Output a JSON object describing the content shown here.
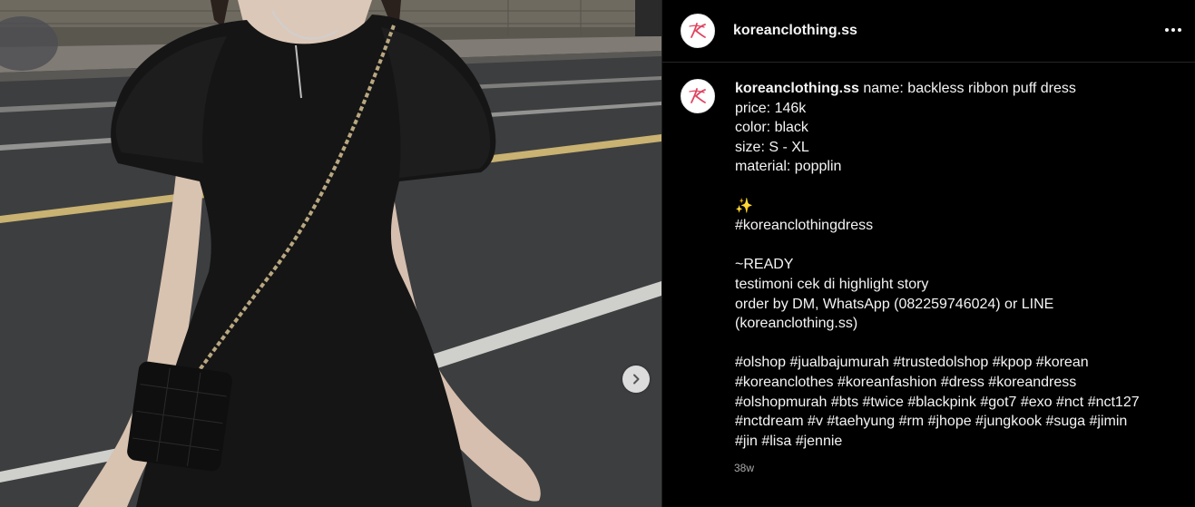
{
  "post": {
    "username": "koreanclothing.ss",
    "timestamp": "38w",
    "caption": {
      "username": "koreanclothing.ss",
      "first_line": "name: backless ribbon puff dress",
      "lines": [
        "price: 146k",
        "color: black",
        "size: S - XL",
        "material: popplin"
      ],
      "sparkle": "✨",
      "tag_line": "#koreanclothingdress",
      "ready_lines": [
        "~READY",
        "testimoni cek di highlight story",
        "order by DM, WhatsApp (082259746024) or LINE",
        "(koreanclothing.ss)"
      ],
      "hashtag_lines": [
        "#olshop #jualbajumurah #trustedolshop #kpop #korean",
        "#koreanclothes #koreanfashion #dress #koreandress",
        "#olshopmurah #bts #twice #blackpink #got7 #exo #nct #nct127",
        "#nctdream #v #taehyung #rm #jhope #jungkook #suga #jimin",
        "#jin #lisa #jennie"
      ]
    }
  },
  "icons": {
    "avatar": "k-logo-icon",
    "more": "more-options-icon",
    "next": "chevron-right-icon"
  },
  "colors": {
    "panel_bg": "#000000",
    "text": "#f5f5f5",
    "muted": "#a8a8a8",
    "logo_pink": "#e0445f"
  }
}
